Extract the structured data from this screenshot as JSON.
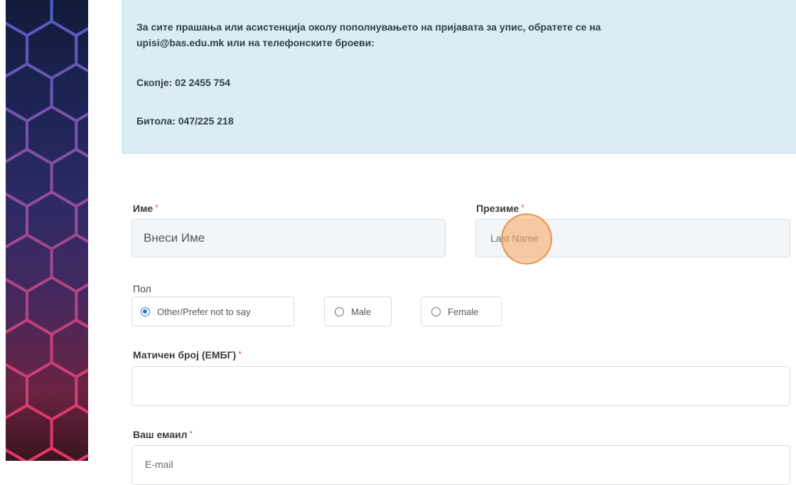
{
  "info": {
    "line1": "За сите прашања или асистенција околу пополнувањето на пријавата за упис, обратете се на",
    "line2": "upisi@bas.edu.mk или на телефонските броеви:",
    "skopje": "Скопје: 02 2455 754",
    "bitola": "Битола: 047/225 218"
  },
  "form": {
    "first_name": {
      "label": "Име",
      "placeholder": "Внеси Име"
    },
    "last_name": {
      "label": "Презиме",
      "placeholder": "Last Name"
    },
    "gender": {
      "label": "Пол",
      "options": [
        "Other/Prefer not to say",
        "Male",
        "Female"
      ],
      "selected": "Other/Prefer not to say"
    },
    "embg": {
      "label": "Матичен број (ЕМБГ)",
      "value": ""
    },
    "email": {
      "label": "Ваш емаил",
      "placeholder": "E-mail"
    },
    "required_marker": "*"
  },
  "colors": {
    "info_bg": "#d9edf3",
    "radio_accent": "#1f78d8",
    "required": "#e05a5a",
    "click_highlight": "#f5a65c"
  }
}
